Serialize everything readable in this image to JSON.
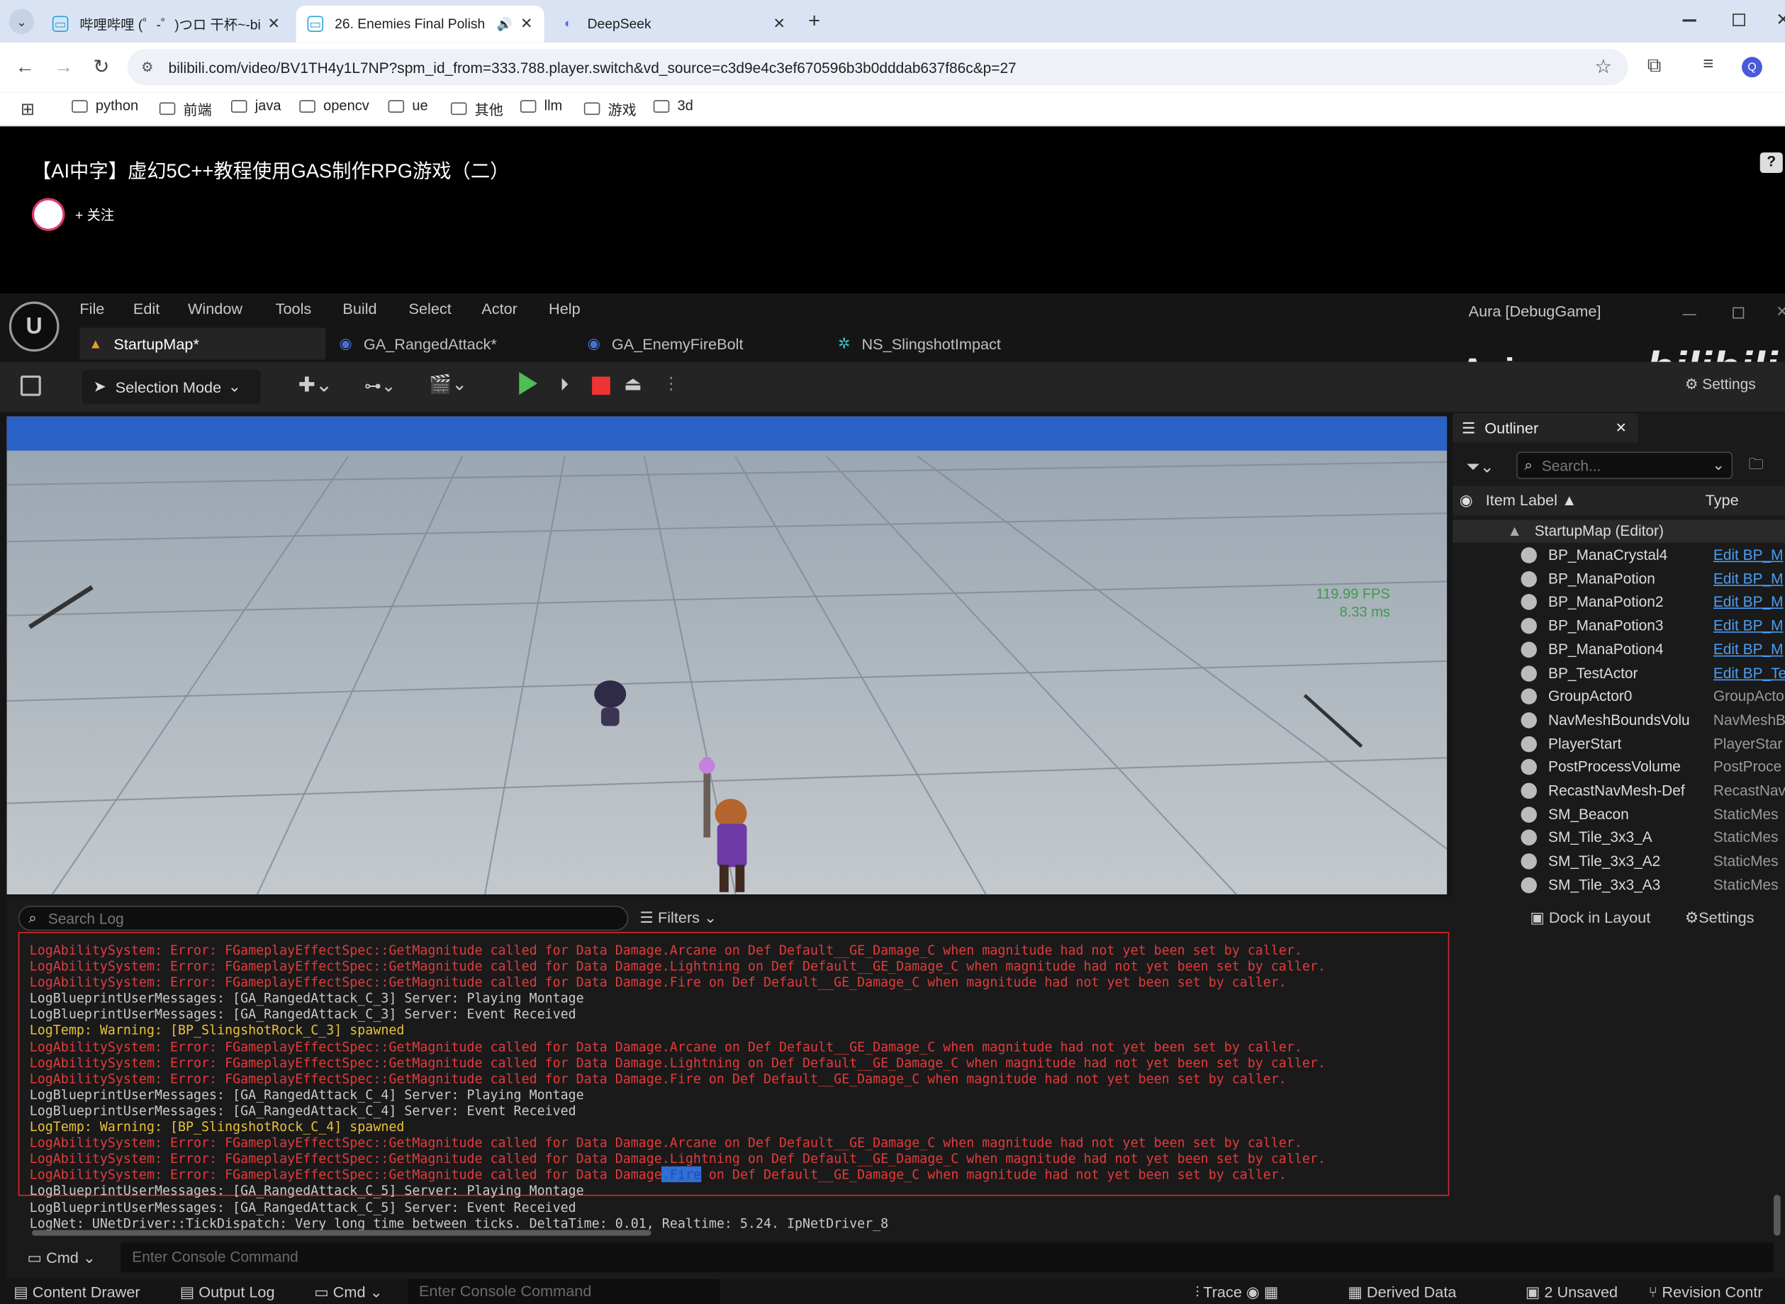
{
  "browser": {
    "tabs": [
      {
        "label": "哔哩哔哩 (゜-゜)つロ 干杯~-bi",
        "active": false
      },
      {
        "label": "26. Enemies Final Polish",
        "active": true
      },
      {
        "label": "DeepSeek",
        "active": false
      }
    ],
    "new_tab": "+",
    "url": "bilibili.com/video/BV1TH4y1L7NP?spm_id_from=333.788.player.switch&vd_source=c3d9e4c3ef670596b3b0dddab637f86c&p=27",
    "profile_initial": "Q",
    "bookmarks": [
      "python",
      "前端",
      "java",
      "opencv",
      "ue",
      "其他",
      "llm",
      "游戏",
      "3d"
    ]
  },
  "bili": {
    "video_title": "【AI中字】虚幻5C++教程使用GAS制作RPG游戏（二）",
    "follow_label": "+ 关注",
    "help": "?"
  },
  "ue": {
    "menus": [
      "File",
      "Edit",
      "Window",
      "Tools",
      "Build",
      "Select",
      "Actor",
      "Help"
    ],
    "project": "Aura [DebugGame]",
    "watermark": "Ayimuzus",
    "tabs": [
      "StartupMap*",
      "GA_RangedAttack*",
      "GA_EnemyFireBolt",
      "NS_SlingshotImpact"
    ],
    "selection_mode": "Selection Mode",
    "settings": "Settings",
    "fps": "119.99 FPS",
    "ms": "8.33 ms",
    "outliner": {
      "title": "Outliner",
      "search_placeholder": "Search...",
      "col_label": "Item Label",
      "col_type": "Type",
      "root": "StartupMap (Editor)",
      "items": [
        {
          "name": "BP_ManaCrystal4",
          "type": "Edit BP_M",
          "link": true
        },
        {
          "name": "BP_ManaPotion",
          "type": "Edit BP_M",
          "link": true
        },
        {
          "name": "BP_ManaPotion2",
          "type": "Edit BP_M",
          "link": true
        },
        {
          "name": "BP_ManaPotion3",
          "type": "Edit BP_M",
          "link": true
        },
        {
          "name": "BP_ManaPotion4",
          "type": "Edit BP_M",
          "link": true
        },
        {
          "name": "BP_TestActor",
          "type": "Edit BP_Te",
          "link": true
        },
        {
          "name": "GroupActor0",
          "type": "GroupActo",
          "link": false
        },
        {
          "name": "NavMeshBoundsVolu",
          "type": "NavMeshB",
          "link": false
        },
        {
          "name": "PlayerStart",
          "type": "PlayerStar",
          "link": false
        },
        {
          "name": "PostProcessVolume",
          "type": "PostProce",
          "link": false
        },
        {
          "name": "RecastNavMesh-Def",
          "type": "RecastNav",
          "link": false
        },
        {
          "name": "SM_Beacon",
          "type": "StaticMes",
          "link": false
        },
        {
          "name": "SM_Tile_3x3_A",
          "type": "StaticMes",
          "link": false
        },
        {
          "name": "SM_Tile_3x3_A2",
          "type": "StaticMes",
          "link": false
        },
        {
          "name": "SM_Tile_3x3_A3",
          "type": "StaticMes",
          "link": false
        }
      ]
    },
    "log": {
      "search_placeholder": "Search Log",
      "filters": "Filters",
      "dock": "Dock in Layout",
      "settings": "Settings",
      "lines": [
        {
          "t": "LogAbilitySystem: Error: FGameplayEffectSpec::GetMagnitude called for Data Damage.Arcane on Def Default__GE_Damage_C when magnitude had not yet been set by caller.",
          "c": "err"
        },
        {
          "t": "LogAbilitySystem: Error: FGameplayEffectSpec::GetMagnitude called for Data Damage.Lightning on Def Default__GE_Damage_C when magnitude had not yet been set by caller.",
          "c": "err"
        },
        {
          "t": "LogAbilitySystem: Error: FGameplayEffectSpec::GetMagnitude called for Data Damage.Fire on Def Default__GE_Damage_C when magnitude had not yet been set by caller.",
          "c": "err"
        },
        {
          "t": "LogBlueprintUserMessages: [GA_RangedAttack_C_3] Server: Playing Montage",
          "c": "info"
        },
        {
          "t": "LogBlueprintUserMessages: [GA_RangedAttack_C_3] Server: Event Received",
          "c": "info"
        },
        {
          "t": "LogTemp: Warning: [BP_SlingshotRock_C_3] spawned",
          "c": "warn"
        },
        {
          "t": "LogAbilitySystem: Error: FGameplayEffectSpec::GetMagnitude called for Data Damage.Arcane on Def Default__GE_Damage_C when magnitude had not yet been set by caller.",
          "c": "err"
        },
        {
          "t": "LogAbilitySystem: Error: FGameplayEffectSpec::GetMagnitude called for Data Damage.Lightning on Def Default__GE_Damage_C when magnitude had not yet been set by caller.",
          "c": "err"
        },
        {
          "t": "LogAbilitySystem: Error: FGameplayEffectSpec::GetMagnitude called for Data Damage.Fire on Def Default__GE_Damage_C when magnitude had not yet been set by caller.",
          "c": "err"
        },
        {
          "t": "LogBlueprintUserMessages: [GA_RangedAttack_C_4] Server: Playing Montage",
          "c": "info"
        },
        {
          "t": "LogBlueprintUserMessages: [GA_RangedAttack_C_4] Server: Event Received",
          "c": "info"
        },
        {
          "t": "LogTemp: Warning: [BP_SlingshotRock_C_4] spawned",
          "c": "warn"
        },
        {
          "t": "LogAbilitySystem: Error: FGameplayEffectSpec::GetMagnitude called for Data Damage.Arcane on Def Default__GE_Damage_C when magnitude had not yet been set by caller.",
          "c": "err"
        },
        {
          "t": "LogAbilitySystem: Error: FGameplayEffectSpec::GetMagnitude called for Data Damage.Lightning on Def Default__GE_Damage_C when magnitude had not yet been set by caller.",
          "c": "err"
        },
        {
          "t": "LogAbilitySystem: Error: FGameplayEffectSpec::GetMagnitude called for Data Damage.Fire on Def Default__GE_Damage_C when magnitude had not yet been set by caller.",
          "c": "err",
          "hl": ".Fire"
        },
        {
          "t": "LogBlueprintUserMessages: [GA_RangedAttack_C_5] Server: Playing Montage",
          "c": "info"
        },
        {
          "t": "LogBlueprintUserMessages: [GA_RangedAttack_C_5] Server: Event Received",
          "c": "info"
        },
        {
          "t": "LogNet: UNetDriver::TickDispatch: Very long time between ticks. DeltaTime: 0.01, Realtime: 5.24. IpNetDriver_8",
          "c": "info"
        }
      ],
      "cmd_label": "Cmd",
      "cmd_placeholder": "Enter Console Command"
    },
    "status": {
      "content_drawer": "Content Drawer",
      "output_log": "Output Log",
      "cmd": "Cmd",
      "cmd_placeholder": "Enter Console Command",
      "trace": "Trace",
      "derived_data": "Derived Data",
      "unsaved": "2 Unsaved",
      "revision": "Revision Contr"
    }
  }
}
